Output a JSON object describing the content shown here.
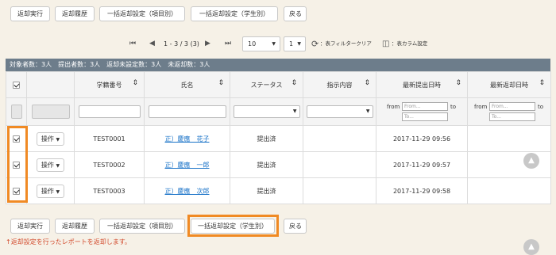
{
  "top_buttons": [
    "返却実行",
    "返却履歴",
    "一括返却設定（項目別）",
    "一括返却設定（学生別）",
    "戻る"
  ],
  "bottom_buttons": [
    "返却実行",
    "返却履歴",
    "一括返却設定（項目別）",
    "一括返却設定（学生別）",
    "戻る"
  ],
  "pager": {
    "first": "⏮",
    "prev": "◀",
    "range_text": "1 - 3 / 3 (3)",
    "next": "▶",
    "last": "⏭",
    "per_page": "10",
    "page": "1",
    "clear_filter": "：表フィルタークリア",
    "column_settings": "：表カラム設定"
  },
  "summary": "対象者数：3人　提出者数：3人　返却未設定数：3人　未返却数：3人",
  "columns": [
    "学籍番号",
    "氏名",
    "ステータス",
    "指示内容",
    "最新提出日時",
    "最新返却日時"
  ],
  "filter": {
    "from_label": "from",
    "to_label": "to",
    "from_placeholder": "From...",
    "to_placeholder": "To..."
  },
  "op_label": "操作",
  "rows": [
    {
      "id": "TEST0001",
      "name": "正）慶應　花子",
      "status": "提出済",
      "submitted": "2017-11-29 09:56"
    },
    {
      "id": "TEST0002",
      "name": "正）慶應　一郎",
      "status": "提出済",
      "submitted": "2017-11-29 09:57"
    },
    {
      "id": "TEST0003",
      "name": "正）慶應　次郎",
      "status": "提出済",
      "submitted": "2017-11-29 09:58"
    }
  ],
  "note": "↑返却設定を行ったレポートを返却します。",
  "colors": {
    "highlight": "#f08a24",
    "summary_bg": "#6d7d8b",
    "note": "#d24a2c",
    "link": "#1a73c8"
  }
}
